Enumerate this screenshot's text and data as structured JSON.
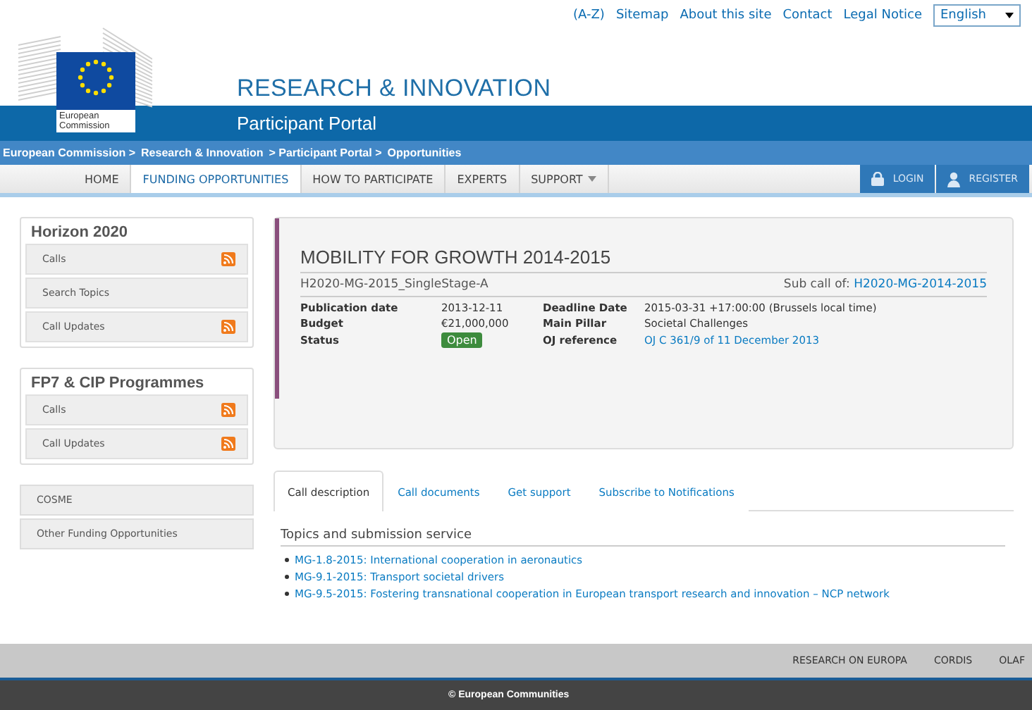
{
  "header": {
    "top_links": [
      "(A-Z)",
      "Sitemap",
      "About this site",
      "Contact",
      "Legal Notice"
    ],
    "language": "English",
    "logo_text": "European Commission",
    "site_title": "RESEARCH & INNOVATION",
    "portal_title": "Participant Portal",
    "breadcrumb": [
      "European Commission >",
      "Research & Innovation",
      "> Participant Portal >",
      "Opportunities"
    ]
  },
  "nav": {
    "items": [
      {
        "label": "HOME",
        "selected": false,
        "has_menu": false
      },
      {
        "label": "FUNDING OPPORTUNITIES",
        "selected": true,
        "has_menu": false
      },
      {
        "label": "HOW TO PARTICIPATE",
        "selected": false,
        "has_menu": false
      },
      {
        "label": "EXPERTS",
        "selected": false,
        "has_menu": false
      },
      {
        "label": "SUPPORT",
        "selected": false,
        "has_menu": true
      }
    ],
    "user_buttons": [
      {
        "label": "LOGIN",
        "kind": "lock"
      },
      {
        "label": "REGISTER",
        "kind": "person"
      }
    ]
  },
  "sidebar": {
    "groups": [
      {
        "title": "Horizon 2020",
        "items": [
          {
            "label": "Calls",
            "rss": true
          },
          {
            "label": "Search Topics",
            "rss": false
          },
          {
            "label": "Call Updates",
            "rss": true
          }
        ]
      },
      {
        "title": "FP7 & CIP Programmes",
        "items": [
          {
            "label": "Calls",
            "rss": true
          },
          {
            "label": "Call Updates",
            "rss": true
          }
        ]
      }
    ],
    "links": [
      "COSME",
      "Other Funding Opportunities"
    ]
  },
  "call": {
    "title": "MOBILITY FOR GROWTH 2014-2015",
    "identifier": "H2020-MG-2015_SingleStage-A",
    "subcall_label": "Sub call of:",
    "subcall_link": "H2020-MG-2014-2015",
    "fields": [
      {
        "label": "Publication date",
        "value": "2013-12-11",
        "kind": "text"
      },
      {
        "label": "Deadline Date",
        "value": "2015-03-31 +17:00:00 (Brussels local time)",
        "kind": "text"
      },
      {
        "label": "Budget",
        "value": "€21,000,000",
        "kind": "text"
      },
      {
        "label": "Main Pillar",
        "value": "Societal Challenges",
        "kind": "text"
      },
      {
        "label": "Status",
        "value": "Open",
        "kind": "badge"
      },
      {
        "label": "OJ reference",
        "value": "OJ C 361/9 of 11 December 2013",
        "kind": "link"
      }
    ]
  },
  "tabs": [
    {
      "label": "Call description",
      "selected": true
    },
    {
      "label": "Call documents",
      "selected": false
    },
    {
      "label": "Get support",
      "selected": false
    },
    {
      "label": "Subscribe to Notifications",
      "selected": false
    }
  ],
  "topics": {
    "heading": "Topics and submission service",
    "items": [
      "MG-1.8-2015: International cooperation in aeronautics",
      "MG-9.1-2015: Transport societal drivers",
      "MG-9.5-2015: Fostering transnational cooperation in European transport research and innovation – NCP network"
    ]
  },
  "footer": {
    "links": [
      "RESEARCH ON EUROPA",
      "CORDIS",
      "OLAF"
    ],
    "copyright": "© European Communities"
  }
}
